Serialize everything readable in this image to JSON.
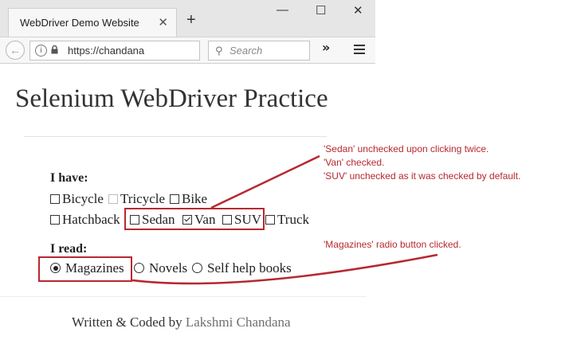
{
  "browser": {
    "tab_title": "WebDriver Demo Website",
    "tab_close": "✕",
    "new_tab": "+",
    "window_controls": [
      "—",
      "☐",
      "✕"
    ],
    "url": "https://chandana",
    "search_placeholder": "Search",
    "overflow": "»"
  },
  "page": {
    "title": "Selenium WebDriver Practice",
    "have_label": "I have:",
    "have_row1": [
      {
        "label": "Bicycle",
        "checked": false
      },
      {
        "label": "Tricycle",
        "checked": false,
        "light": true
      },
      {
        "label": "Bike",
        "checked": false
      }
    ],
    "have_row2": [
      {
        "label": "Hatchback",
        "checked": false
      },
      {
        "label": "Sedan",
        "checked": false
      },
      {
        "label": "Van",
        "checked": true
      },
      {
        "label": "SUV",
        "checked": false
      },
      {
        "label": "Truck",
        "checked": false
      }
    ],
    "read_label": "I read:",
    "read_options": [
      {
        "label": "Magazines",
        "selected": true
      },
      {
        "label": "Novels",
        "selected": false
      },
      {
        "label": "Self help books",
        "selected": false
      }
    ],
    "footer_prefix": "Written & Coded by ",
    "footer_author": "Lakshmi Chandana"
  },
  "annotations": {
    "checkbox_notes": [
      "'Sedan' unchecked upon clicking twice.",
      "'Van' checked.",
      "'SUV' unchecked as it was checked by default."
    ],
    "radio_note": "'Magazines' radio button clicked.",
    "color": "#b7282f"
  }
}
